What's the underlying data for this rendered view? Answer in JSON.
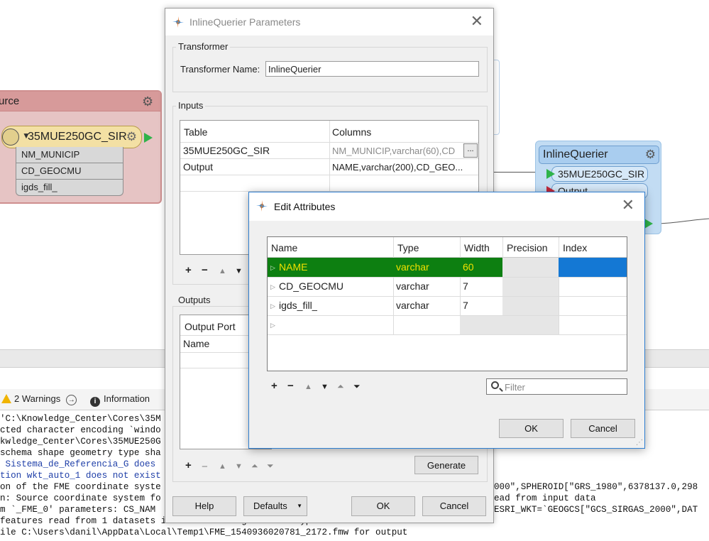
{
  "canvas": {
    "source_node": {
      "header_label": "urce",
      "feature_type": "35MUE250GC_SIR",
      "attributes": [
        "NM_MUNICIP",
        "CD_GEOCMU",
        "igds_fill_"
      ]
    },
    "inline_querier_node": {
      "title": "InlineQuerier",
      "input_port": "35MUE250GC_SIR",
      "output_port": "Output"
    },
    "colors": {
      "source_fill": "#e6c4c4",
      "source_border": "#cf8f8f",
      "querier_fill": "#c2dcf3",
      "port_green": "#2fb34a",
      "port_red": "#c0283c"
    }
  },
  "log": {
    "toolbar": {
      "warnings": "2 Warnings",
      "information": "Information"
    },
    "lines": [
      "'C:\\Knowledge_Center\\Cores\\35M",
      "cted character encoding `windo",
      "kwledge_Center\\Cores\\35MUE250G",
      "schema shape geometry type sha",
      " Sistema_de_Referencia_G does",
      "tion wkt_auto_1 does not exist",
      "on of the FME coordinate syste",
      "n: Source coordinate system fo",
      "m `_FME_0' parameters: CS_NAM",
      "features read from 1 datasets into 1 resulting feature types",
      "ile C:\\Users\\danil\\AppData\\Local\\Temp1\\FME_1540936020781_2172.fmw for output"
    ],
    "right_fragments": [
      "000\",SPHEROID[\"GRS_1980\",6378137.0,298",
      "ead from input data",
      "ESRI_WKT=`GEOGCS[\"GCS_SIRGAS_2000\",DAT"
    ]
  },
  "params_dialog": {
    "title": "InlineQuerier Parameters",
    "transformer_group": "Transformer",
    "transformer_name_label": "Transformer Name:",
    "transformer_name_value": "InlineQuerier",
    "inputs_group": "Inputs",
    "inputs_table": {
      "headers": [
        "Table",
        "Columns"
      ],
      "rows": [
        [
          "35MUE250GC_SIR",
          "NM_MUNICIP,varchar(60),CD"
        ],
        [
          "Output",
          "NAME,varchar(200),CD_GEO..."
        ]
      ],
      "ellipsis": "..."
    },
    "outputs_group": "Outputs",
    "outputs_table": {
      "header": "Output Port",
      "subheader": "Name"
    },
    "toolbar_add": "+",
    "toolbar_remove": "−",
    "toolbar_up": "▲",
    "toolbar_down": "▼",
    "toolbar_top": "⏶",
    "toolbar_bottom": "⏷",
    "generate_button": "Generate",
    "help_button": "Help",
    "defaults_button": "Defaults",
    "defaults_arrow": "▼",
    "ok_button": "OK",
    "cancel_button": "Cancel"
  },
  "edit_dialog": {
    "title": "Edit Attributes",
    "columns": [
      "Name",
      "Type",
      "Width",
      "Precision",
      "Index"
    ],
    "rows": [
      {
        "name": "NAME",
        "type": "varchar",
        "width": "60",
        "precision": "",
        "index": "",
        "selected": true
      },
      {
        "name": "CD_GEOCMU",
        "type": "varchar",
        "width": "7",
        "precision": "",
        "index": "",
        "selected": false
      },
      {
        "name": "igds_fill_",
        "type": "varchar",
        "width": "7",
        "precision": "",
        "index": "",
        "selected": false
      }
    ],
    "filter_placeholder": "Filter",
    "ok_button": "OK",
    "cancel_button": "Cancel",
    "colors": {
      "selection_green": "#0d7f11",
      "selection_blue": "#1478d4",
      "selected_text": "#f0e000",
      "border_accent": "#2f7fd1"
    }
  }
}
